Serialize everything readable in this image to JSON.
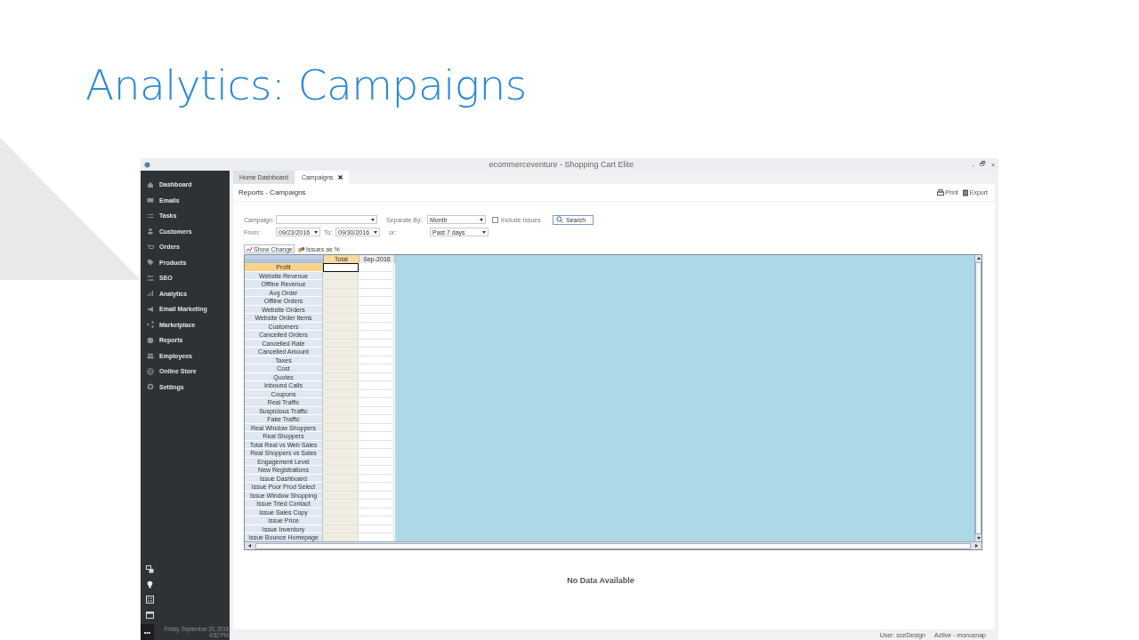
{
  "slide": {
    "title": "Analytics: Campaigns"
  },
  "window": {
    "title": "ecommerceventure - Shopping Cart Elite",
    "controls": [
      "-",
      "🗗",
      "×"
    ]
  },
  "sidebar": {
    "items": [
      {
        "label": "Dashboard"
      },
      {
        "label": "Emails"
      },
      {
        "label": "Tasks"
      },
      {
        "label": "Customers"
      },
      {
        "label": "Orders"
      },
      {
        "label": "Products"
      },
      {
        "label": "SEO"
      },
      {
        "label": "Analytics"
      },
      {
        "label": "Email Marketing"
      },
      {
        "label": "Marketplace"
      },
      {
        "label": "Reports"
      },
      {
        "label": "Employees"
      },
      {
        "label": "Online Store"
      },
      {
        "label": "Settings"
      }
    ],
    "more": "•••",
    "date": "Friday, September 30, 2016",
    "time": "4:52 PM"
  },
  "tabs": [
    {
      "label": "Home Dashboard",
      "selected": false,
      "closable": false
    },
    {
      "label": "Campaigns",
      "selected": true,
      "closable": true
    }
  ],
  "page": {
    "title": "Reports - Campaigns",
    "actions": [
      "Print",
      "Export"
    ]
  },
  "form": {
    "campaign": {
      "label": "Campaign:"
    },
    "separate_by": {
      "label": "Separate By:",
      "value": "Month"
    },
    "include_issues": {
      "label": "Include Issues",
      "checked": false
    },
    "search": "Search",
    "from": {
      "label": "From:",
      "value": "09/23/2016"
    },
    "to": {
      "label": "To:",
      "value": "09/30/2016"
    },
    "or": {
      "label": "or:",
      "value": "Past 7 days"
    }
  },
  "toolbar": [
    {
      "label": "Show Change",
      "selected": true
    },
    {
      "label": "Issues as %",
      "selected": false
    }
  ],
  "grid": {
    "columns": [
      "Total",
      "Sep-2016"
    ],
    "rows": [
      {
        "label": "Profit",
        "selected": true
      },
      {
        "label": "Website Revenue",
        "selected": false
      },
      {
        "label": "Offline Revenue",
        "selected": false
      },
      {
        "label": "Avg Order",
        "selected": false
      },
      {
        "label": "Offline Orders",
        "selected": false
      },
      {
        "label": "Website Orders",
        "selected": false
      },
      {
        "label": "Website Order Items",
        "selected": false
      },
      {
        "label": "Customers",
        "selected": false
      },
      {
        "label": "Cancelled Orders",
        "selected": false
      },
      {
        "label": "Cancelled Rate",
        "selected": false
      },
      {
        "label": "Cancelled Amount",
        "selected": false
      },
      {
        "label": "Taxes",
        "selected": false
      },
      {
        "label": "Cost",
        "selected": false
      },
      {
        "label": "Quotes",
        "selected": false
      },
      {
        "label": "Inbound Calls",
        "selected": false
      },
      {
        "label": "Coupons",
        "selected": false
      },
      {
        "label": "Real Traffic",
        "selected": false
      },
      {
        "label": "Suspicious Traffic",
        "selected": false
      },
      {
        "label": "Fake Traffic",
        "selected": false
      },
      {
        "label": "Real Window Shoppers",
        "selected": false
      },
      {
        "label": "Real Shoppers",
        "selected": false
      },
      {
        "label": "Total Real vs Web Sales",
        "selected": false
      },
      {
        "label": "Real Shoppers vs Sales",
        "selected": false
      },
      {
        "label": "Engagement Level",
        "selected": false
      },
      {
        "label": "New Registrations",
        "selected": false
      },
      {
        "label": "Issue Dashboard",
        "selected": false
      },
      {
        "label": "Issue Poor Prod Select",
        "selected": false
      },
      {
        "label": "Issue Window Shopping",
        "selected": false
      },
      {
        "label": "Issue Tried Contact",
        "selected": false
      },
      {
        "label": "Issue Sales Copy",
        "selected": false
      },
      {
        "label": "Issue Price",
        "selected": false
      },
      {
        "label": "Issue Inventory",
        "selected": false
      },
      {
        "label": "Issue Bounce Homepage",
        "selected": false
      }
    ]
  },
  "empty_message": "No Data Available",
  "status_bar": [
    "User: sceDesign",
    "Active - monosnap"
  ]
}
